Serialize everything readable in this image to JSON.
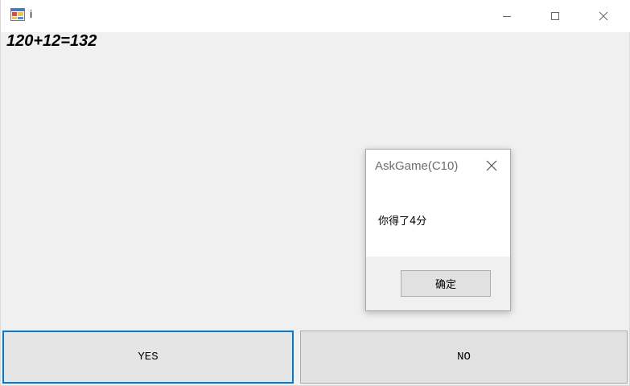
{
  "window": {
    "title": "i",
    "icon": "form-icon",
    "controls": {
      "minimize": "minimize-icon",
      "maximize": "maximize-icon",
      "close": "close-icon"
    }
  },
  "main": {
    "equation": "120+12=132",
    "yes_label": "YES",
    "no_label": "NO"
  },
  "dialog": {
    "title": "AskGame(C10)",
    "message": "你得了4分",
    "ok_label": "确定",
    "close_icon": "close-icon"
  },
  "colors": {
    "focus_border": "#0078d7",
    "button_face": "#e1e1e1",
    "window_bg": "#f0f0f0"
  }
}
